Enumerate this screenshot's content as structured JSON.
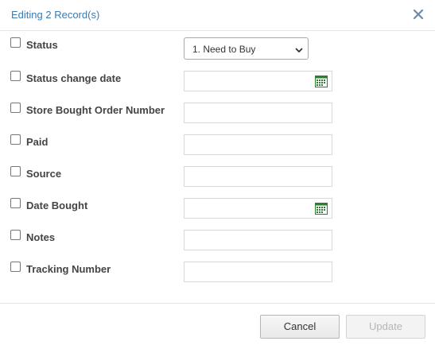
{
  "dialog": {
    "title": "Editing 2 Record(s)",
    "close_icon": "close-icon"
  },
  "fields": [
    {
      "label": "Status",
      "type": "select",
      "value": "1. Need to Buy"
    },
    {
      "label": "Status change date",
      "type": "date",
      "value": ""
    },
    {
      "label": "Store Bought Order Number",
      "type": "text",
      "value": ""
    },
    {
      "label": "Paid",
      "type": "text",
      "value": ""
    },
    {
      "label": "Source",
      "type": "text",
      "value": ""
    },
    {
      "label": "Date Bought",
      "type": "date",
      "value": ""
    },
    {
      "label": "Notes",
      "type": "text",
      "value": ""
    },
    {
      "label": "Tracking Number",
      "type": "text",
      "value": ""
    }
  ],
  "buttons": {
    "cancel": "Cancel",
    "update": "Update"
  },
  "colors": {
    "title": "#3a7bb1",
    "calendar_green": "#2e7d32"
  }
}
